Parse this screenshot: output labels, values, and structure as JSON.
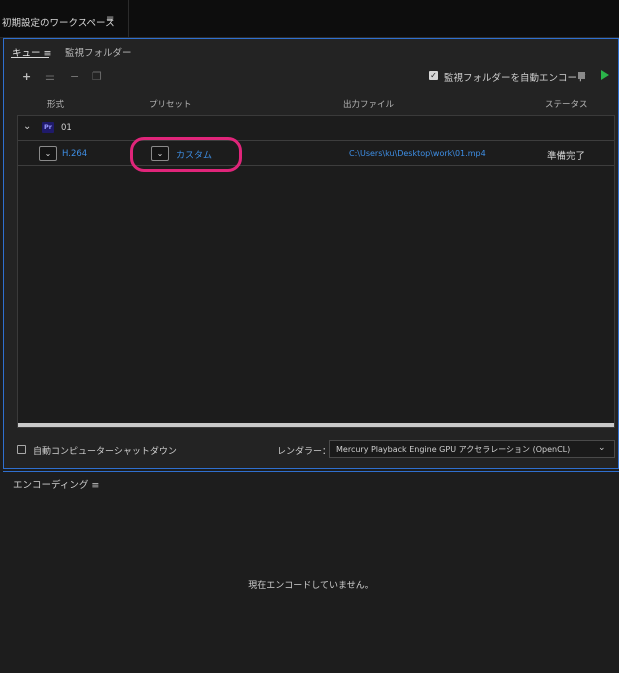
{
  "workspace": {
    "title": "初期設定のワークスペース",
    "menu_icon": "≡"
  },
  "queue_panel": {
    "tabs": [
      {
        "label": "キュー ≡",
        "active": true
      },
      {
        "label": "監視フォルダー",
        "active": false
      }
    ],
    "toolbar": {
      "add": "+",
      "settings": "⚌",
      "remove": "−",
      "duplicate": "❐",
      "auto_encode_label": "監視フォルダーを自動エンコード",
      "auto_encode_checked": true
    },
    "columns": {
      "format": "形式",
      "preset": "プリセット",
      "output": "出力ファイル",
      "status": "ステータス"
    },
    "groups": [
      {
        "app_badge": "Pr",
        "name": "01",
        "items": [
          {
            "format": "H.264",
            "preset": "カスタム",
            "output": "C:\\Users\\ku\\Desktop\\work\\01.mp4",
            "status": "準備完了"
          }
        ]
      }
    ],
    "auto_shutdown_label": "自動コンピューターシャットダウン",
    "auto_shutdown_checked": false,
    "renderer_label": "レンダラー：",
    "renderer_value": "Mercury Playback Engine GPU アクセラレーション (OpenCL)"
  },
  "encoding_panel": {
    "title": "エンコーディング ≡",
    "empty_message": "現在エンコードしていません。"
  },
  "colors": {
    "accent_blue": "#3e8fe6",
    "focus_border": "#2f6fcf",
    "highlight_pink": "#e0257a",
    "play_green": "#2bb34a"
  }
}
